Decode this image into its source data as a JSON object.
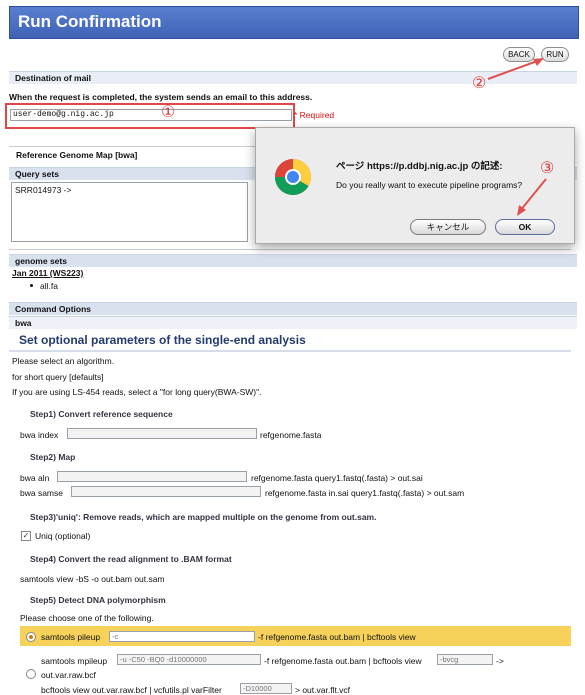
{
  "page": {
    "title": "Run Confirmation"
  },
  "toolbar": {
    "back_label": "BACK",
    "run_label": "RUN"
  },
  "mail": {
    "section_title": "Destination of mail",
    "description": "When the request is completed, the system sends an email to this address.",
    "email_value": "user-demo@g.nig.ac.jp",
    "required_label": "* Required"
  },
  "annotations": {
    "one": "①",
    "two": "②",
    "three": "③"
  },
  "reference": {
    "section_title": "Reference Genome Map [bwa]"
  },
  "query_sets": {
    "title": "Query sets",
    "items": [
      "SRR014973 ->"
    ]
  },
  "genome_sets": {
    "title": "genome sets",
    "release": "Jan 2011 (WS223)",
    "file": "all.fa"
  },
  "command_options": {
    "title": "Command Options",
    "tool": "bwa",
    "heading": "Set optional parameters of the single-end analysis",
    "intro_lines": [
      "Please select an algorithm.",
      "for short query [defaults]",
      "If you are using LS-454 reads, select a \"for long query(BWA-SW)\"."
    ],
    "step1": {
      "title": "Step1) Convert reference sequence",
      "cmd": "bwa index",
      "suffix": "refgenome.fasta"
    },
    "step2": {
      "title": "Step2) Map",
      "aln_cmd": "bwa aln",
      "aln_suffix": "refgenome.fasta query1.fastq(.fasta) > out.sai",
      "samse_cmd": "bwa samse",
      "samse_suffix": "refgenome.fasta in.sai query1.fastq(.fasta) > out.sam"
    },
    "step3": {
      "title": "Step3)'uniq': Remove reads, which are mapped multiple on the genome from out.sam.",
      "uniq_label": "Uniq (optional)"
    },
    "step4": {
      "title": "Step4) Convert the read alignment to .BAM format",
      "cmd": "samtools view -bS -o out.bam out.sam"
    },
    "step5": {
      "title": "Step5) Detect DNA polymorphism",
      "choose": "Please choose one of the following.",
      "opt1_cmd": "samtools pileup",
      "opt1_value": "-c",
      "opt1_suffix": "-f refgenome.fasta out.bam | bcftools view",
      "opt2_cmd": "samtools mpileup",
      "opt2_value": "-u -C50 -BQ0 -d10000000",
      "opt2_mid": "-f refgenome.fasta out.bam | bcftools view",
      "opt2_value2": "-bvcg",
      "opt2_arrow": "->",
      "opt2_line2": "out.var.raw.bcf",
      "opt2_line3_prefix": "bcftools view out.var.raw.bcf | vcfutils.pl varFilter",
      "opt2_line3_value": "-D10000",
      "opt2_line3_suffix": "> out.var.flt.vcf"
    }
  },
  "dialog": {
    "title": "ページ https://p.ddbj.nig.ac.jp の記述:",
    "message": "Do you really want to execute pipeline programs?",
    "cancel_label": "キャンセル",
    "ok_label": "OK"
  }
}
